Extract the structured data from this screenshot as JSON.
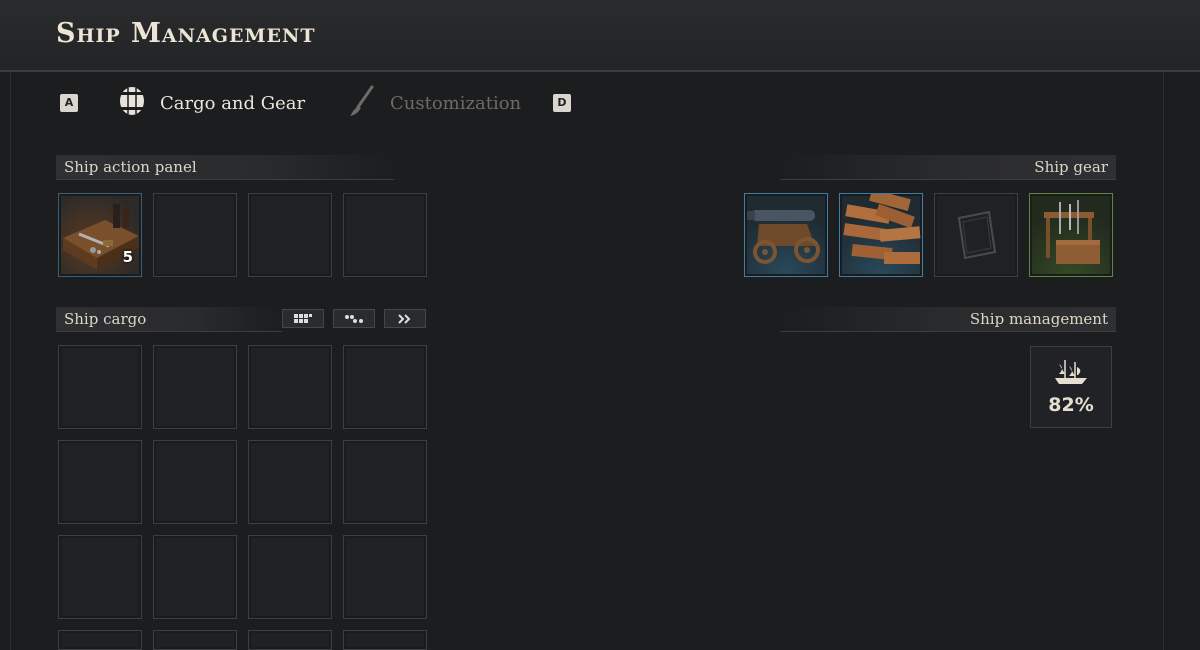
{
  "header": {
    "title": "Ship Management"
  },
  "tabs": {
    "prev_key": "A",
    "next_key": "D",
    "items": [
      {
        "label": "Cargo and Gear",
        "icon": "barrel-icon",
        "active": true
      },
      {
        "label": "Customization",
        "icon": "brush-icon",
        "active": false
      }
    ]
  },
  "action_panel": {
    "title": "Ship action panel",
    "slots": [
      {
        "item": "repair-kit",
        "count": "5"
      },
      {
        "item": null
      },
      {
        "item": null
      },
      {
        "item": null
      }
    ]
  },
  "gear": {
    "title": "Ship gear",
    "slots": [
      {
        "item": "cannon-icon",
        "rarity_color": "#3e7fa6"
      },
      {
        "item": "wooden-planks-icon",
        "rarity_color": "#3e7fa6"
      },
      {
        "item": "empty-plate-icon"
      },
      {
        "item": "crew-tools-icon",
        "rarity_color": "#5b8a3c"
      }
    ]
  },
  "cargo": {
    "title": "Ship cargo",
    "sort_buttons": [
      "grid-sort-icon",
      "cluster-sort-icon",
      "transfer-all-icon"
    ]
  },
  "management": {
    "title": "Ship management",
    "ship_icon": "ship-icon",
    "condition": "82%"
  }
}
